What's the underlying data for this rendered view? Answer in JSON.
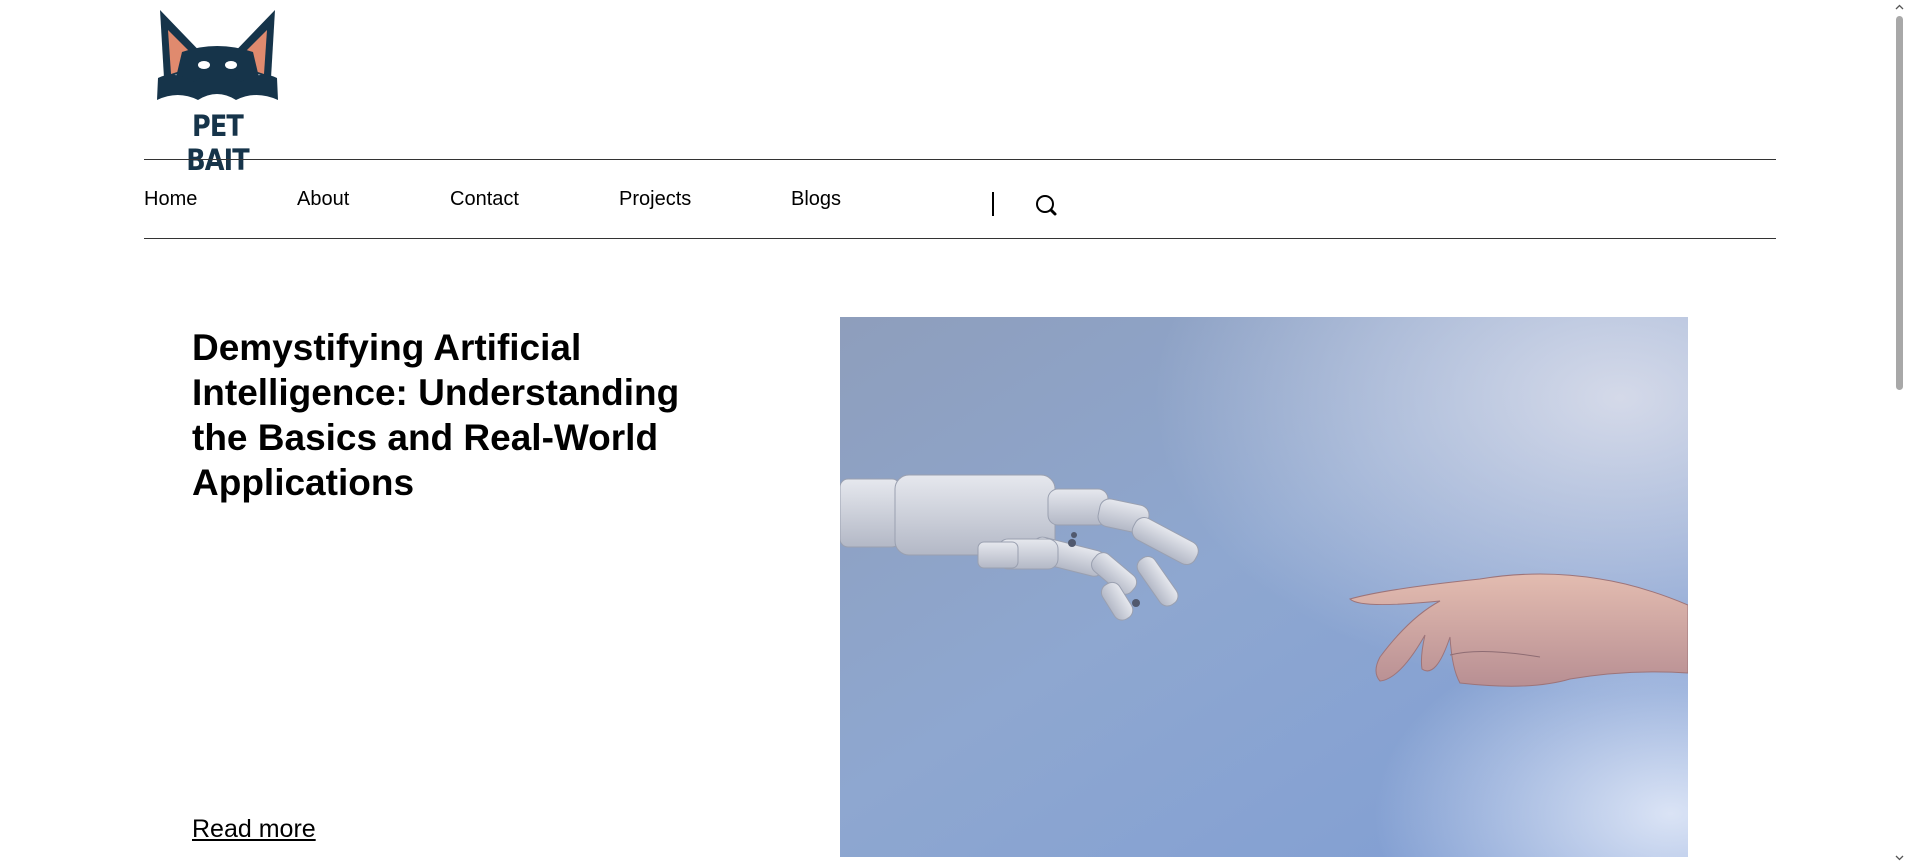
{
  "brand": {
    "name": "PET BAIT",
    "colors": {
      "navy": "#16344a",
      "ear": "#e08a6e"
    }
  },
  "nav": {
    "items": [
      {
        "label": "Home"
      },
      {
        "label": "About"
      },
      {
        "label": "Contact"
      },
      {
        "label": "Projects"
      },
      {
        "label": "Blogs"
      }
    ],
    "search_icon": "search-icon"
  },
  "hero": {
    "title": "Demystifying Artificial Intelligence: Understanding the Basics and Real-World Applications",
    "read_more": "Read more",
    "image_icon": "robot-and-human-hand-image"
  }
}
